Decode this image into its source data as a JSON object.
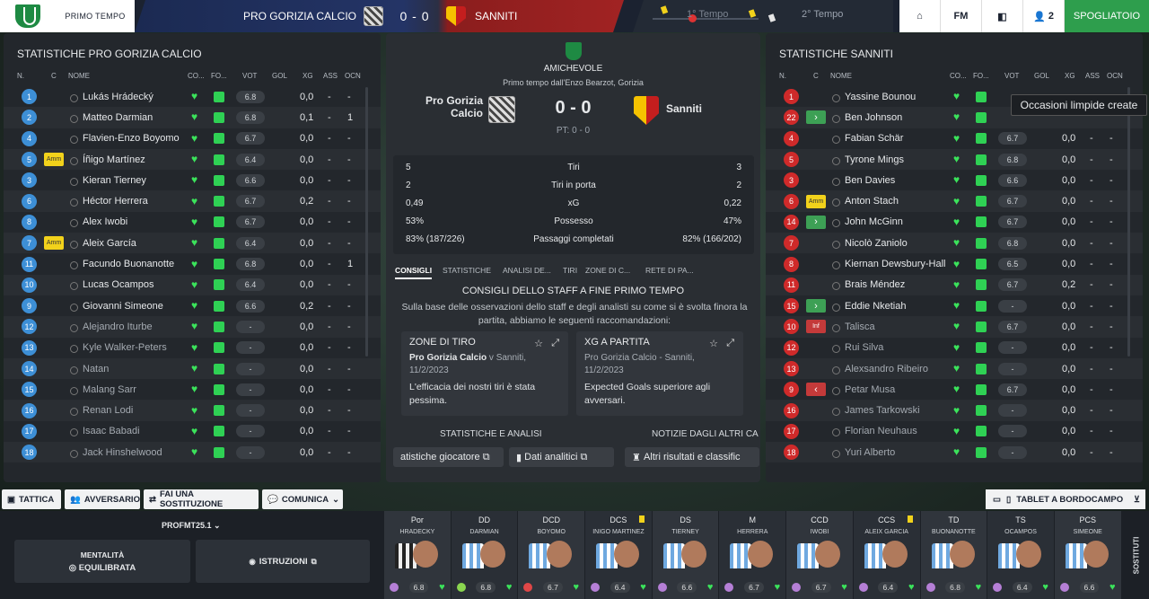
{
  "topbar": {
    "period": "PRIMO TEMPO",
    "home": "PRO GORIZIA CALCIO",
    "score": "0 - 0",
    "away": "SANNITI",
    "first_half": "1° Tempo",
    "second_half": "2° Tempo",
    "players_count": "2",
    "fm": "FM",
    "spogliatoio": "SPOGLIATOIO"
  },
  "left": {
    "title": "STATISTICHE PRO GORIZIA CALCIO"
  },
  "right": {
    "title": "STATISTICHE SANNITI"
  },
  "headers": {
    "n": "N.",
    "c": "C",
    "nome": "NOME",
    "co": "CO...",
    "fo": "FO...",
    "vot": "VOT",
    "gol": "GOL",
    "xg": "XG",
    "ass": "ASS",
    "ocn": "OCN"
  },
  "home_players": [
    {
      "n": "1",
      "c": "",
      "name": "Lukás Hrádecký",
      "vote": "6.8",
      "xg": "0,0",
      "ass": "-",
      "ocn": "-",
      "sub": false
    },
    {
      "n": "2",
      "c": "",
      "name": "Matteo Darmian",
      "vote": "6.8",
      "xg": "0,1",
      "ass": "-",
      "ocn": "1",
      "sub": false
    },
    {
      "n": "4",
      "c": "",
      "name": "Flavien-Enzo Boyomo",
      "vote": "6.7",
      "xg": "0,0",
      "ass": "-",
      "ocn": "-",
      "sub": false
    },
    {
      "n": "5",
      "c": "Amm",
      "name": "Íñigo Martínez",
      "vote": "6.4",
      "xg": "0,0",
      "ass": "-",
      "ocn": "-",
      "sub": false
    },
    {
      "n": "3",
      "c": "",
      "name": "Kieran Tierney",
      "vote": "6.6",
      "xg": "0,0",
      "ass": "-",
      "ocn": "-",
      "sub": false
    },
    {
      "n": "6",
      "c": "",
      "name": "Héctor Herrera",
      "vote": "6.7",
      "xg": "0,2",
      "ass": "-",
      "ocn": "-",
      "sub": false
    },
    {
      "n": "8",
      "c": "",
      "name": "Alex Iwobi",
      "vote": "6.7",
      "xg": "0,0",
      "ass": "-",
      "ocn": "-",
      "sub": false
    },
    {
      "n": "7",
      "c": "Amm",
      "name": "Aleix García",
      "vote": "6.4",
      "xg": "0,0",
      "ass": "-",
      "ocn": "-",
      "sub": false
    },
    {
      "n": "11",
      "c": "",
      "name": "Facundo Buonanotte",
      "vote": "6.8",
      "xg": "0,0",
      "ass": "-",
      "ocn": "1",
      "sub": false
    },
    {
      "n": "10",
      "c": "",
      "name": "Lucas Ocampos",
      "vote": "6.4",
      "xg": "0,0",
      "ass": "-",
      "ocn": "-",
      "sub": false
    },
    {
      "n": "9",
      "c": "",
      "name": "Giovanni Simeone",
      "vote": "6.6",
      "xg": "0,2",
      "ass": "-",
      "ocn": "-",
      "sub": false
    },
    {
      "n": "12",
      "c": "",
      "name": "Alejandro Iturbe",
      "vote": "-",
      "xg": "0,0",
      "ass": "-",
      "ocn": "-",
      "sub": true
    },
    {
      "n": "13",
      "c": "",
      "name": "Kyle Walker-Peters",
      "vote": "-",
      "xg": "0,0",
      "ass": "-",
      "ocn": "-",
      "sub": true
    },
    {
      "n": "14",
      "c": "",
      "name": "Natan",
      "vote": "-",
      "xg": "0,0",
      "ass": "-",
      "ocn": "-",
      "sub": true
    },
    {
      "n": "15",
      "c": "",
      "name": "Malang Sarr",
      "vote": "-",
      "xg": "0,0",
      "ass": "-",
      "ocn": "-",
      "sub": true
    },
    {
      "n": "16",
      "c": "",
      "name": "Renan Lodi",
      "vote": "-",
      "xg": "0,0",
      "ass": "-",
      "ocn": "-",
      "sub": true
    },
    {
      "n": "17",
      "c": "",
      "name": "Isaac Babadi",
      "vote": "-",
      "xg": "0,0",
      "ass": "-",
      "ocn": "-",
      "sub": true
    },
    {
      "n": "18",
      "c": "",
      "name": "Jack Hinshelwood",
      "vote": "-",
      "xg": "0,0",
      "ass": "-",
      "ocn": "-",
      "sub": true
    }
  ],
  "away_players": [
    {
      "n": "1",
      "c": "",
      "name": "Yassine Bounou",
      "vote": "",
      "xg": "",
      "ass": "",
      "ocn": "",
      "sub": false
    },
    {
      "n": "22",
      "c": "in",
      "name": "Ben Johnson",
      "vote": "",
      "xg": "",
      "ass": "",
      "ocn": "",
      "sub": false
    },
    {
      "n": "4",
      "c": "",
      "name": "Fabian Schär",
      "vote": "6.7",
      "xg": "0,0",
      "ass": "-",
      "ocn": "-",
      "sub": false
    },
    {
      "n": "5",
      "c": "",
      "name": "Tyrone Mings",
      "vote": "6.8",
      "xg": "0,0",
      "ass": "-",
      "ocn": "-",
      "sub": false
    },
    {
      "n": "3",
      "c": "",
      "name": "Ben Davies",
      "vote": "6.6",
      "xg": "0,0",
      "ass": "-",
      "ocn": "-",
      "sub": false
    },
    {
      "n": "6",
      "c": "Amm",
      "name": "Anton Stach",
      "vote": "6.7",
      "xg": "0,0",
      "ass": "-",
      "ocn": "-",
      "sub": false
    },
    {
      "n": "14",
      "c": "in",
      "name": "John McGinn",
      "vote": "6.7",
      "xg": "0,0",
      "ass": "-",
      "ocn": "-",
      "sub": false
    },
    {
      "n": "7",
      "c": "",
      "name": "Nicolò Zaniolo",
      "vote": "6.8",
      "xg": "0,0",
      "ass": "-",
      "ocn": "-",
      "sub": false
    },
    {
      "n": "8",
      "c": "",
      "name": "Kiernan Dewsbury-Hall",
      "vote": "6.5",
      "xg": "0,0",
      "ass": "-",
      "ocn": "-",
      "sub": false
    },
    {
      "n": "11",
      "c": "",
      "name": "Brais Méndez",
      "vote": "6.7",
      "xg": "0,2",
      "ass": "-",
      "ocn": "-",
      "sub": false
    },
    {
      "n": "15",
      "c": "in",
      "name": "Eddie Nketiah",
      "vote": "-",
      "xg": "0,0",
      "ass": "-",
      "ocn": "-",
      "sub": false
    },
    {
      "n": "10",
      "c": "Inf",
      "name": "Talisca",
      "vote": "6.7",
      "xg": "0,0",
      "ass": "-",
      "ocn": "-",
      "sub": true
    },
    {
      "n": "12",
      "c": "",
      "name": "Rui Silva",
      "vote": "-",
      "xg": "0,0",
      "ass": "-",
      "ocn": "-",
      "sub": true
    },
    {
      "n": "13",
      "c": "",
      "name": "Alexsandro Ribeiro",
      "vote": "-",
      "xg": "0,0",
      "ass": "-",
      "ocn": "-",
      "sub": true
    },
    {
      "n": "9",
      "c": "out",
      "name": "Petar Musa",
      "vote": "6.7",
      "xg": "0,0",
      "ass": "-",
      "ocn": "-",
      "sub": true
    },
    {
      "n": "16",
      "c": "",
      "name": "James Tarkowski",
      "vote": "-",
      "xg": "0,0",
      "ass": "-",
      "ocn": "-",
      "sub": true
    },
    {
      "n": "17",
      "c": "",
      "name": "Florian Neuhaus",
      "vote": "-",
      "xg": "0,0",
      "ass": "-",
      "ocn": "-",
      "sub": true
    },
    {
      "n": "18",
      "c": "",
      "name": "Yuri Alberto",
      "vote": "-",
      "xg": "0,0",
      "ass": "-",
      "ocn": "-",
      "sub": true
    }
  ],
  "tooltip": "Occasioni limpide create",
  "mid": {
    "competition": "AMICHEVOLE",
    "venue": "Primo tempo dall'Enzo Bearzot, Gorizia",
    "home_line1": "Pro Gorizia",
    "home_line2": "Calcio",
    "score": "0 - 0",
    "pt": "PT: 0 - 0",
    "away": "Sanniti",
    "stats": [
      {
        "h": "5",
        "label": "Tiri",
        "a": "3"
      },
      {
        "h": "2",
        "label": "Tiri in porta",
        "a": "2"
      },
      {
        "h": "0,49",
        "label": "xG",
        "a": "0,22"
      },
      {
        "h": "53%",
        "label": "Possesso",
        "a": "47%"
      },
      {
        "h": "83% (187/226)",
        "label": "Passaggi completati",
        "a": "82% (166/202)"
      }
    ],
    "tabs": [
      "CONSIGLI",
      "STATISTICHE",
      "ANALISI DE...",
      "TIRI",
      "ZONE DI C...",
      "RETE DI PA..."
    ],
    "advice_title": "CONSIGLI DELLO STAFF A FINE PRIMO TEMPO",
    "advice_desc": "Sulla base delle osservazioni dello staff e degli analisti su come si è svolta finora la partita, abbiamo le seguenti raccomandazioni:",
    "cards": [
      {
        "title": "ZONE DI TIRO",
        "match_b": "Pro Gorizia Calcio",
        "match_r": " v Sanniti, 11/2/2023",
        "body": "L'efficacia dei nostri tiri è stata pessima."
      },
      {
        "title": "XG A PARTITA",
        "match_b": "",
        "match_r": "Pro Gorizia Calcio - Sanniti, 11/2/2023",
        "body": "Expected Goals superiore agli avversari."
      }
    ],
    "section_a": "STATISTICHE E ANALISI",
    "section_b": "NOTIZIE DAGLI ALTRI CA",
    "pills": [
      "atistiche giocatore",
      "Dati analitici",
      "Altri risultati e classific"
    ]
  },
  "toolbar": {
    "tattica": "TATTICA",
    "avversario": "AVVERSARIO",
    "sost": "FAI UNA SOSTITUZIONE",
    "comunica": "COMUNICA",
    "tablet": "TABLET A BORDOCAMPO"
  },
  "bottom": {
    "tactic": "PROFMT25.1",
    "mentalita": "MENTALITÀ",
    "mentalita_val": "EQUILIBRATA",
    "istruzioni": "ISTRUZIONI",
    "sostituti": "SOSTITUTI"
  },
  "strip": [
    {
      "pos": "Por",
      "name": "HRÁDECKÝ",
      "rating": "6.8",
      "mood": "p",
      "yc": false
    },
    {
      "pos": "DD",
      "name": "DARMIAN",
      "rating": "6.8",
      "mood": "g",
      "yc": false
    },
    {
      "pos": "DCD",
      "name": "BOYOMO",
      "rating": "6.7",
      "mood": "r",
      "yc": false
    },
    {
      "pos": "DCS",
      "name": "ÍÑIGO MARTÍNEZ",
      "rating": "6.4",
      "mood": "p",
      "yc": true
    },
    {
      "pos": "DS",
      "name": "TIERNEY",
      "rating": "6.6",
      "mood": "p",
      "yc": false
    },
    {
      "pos": "M",
      "name": "HERRERA",
      "rating": "6.7",
      "mood": "p",
      "yc": false
    },
    {
      "pos": "CCD",
      "name": "IWOBI",
      "rating": "6.7",
      "mood": "p",
      "yc": false
    },
    {
      "pos": "CCS",
      "name": "ALEIX GARCÍA",
      "rating": "6.4",
      "mood": "p",
      "yc": true
    },
    {
      "pos": "TD",
      "name": "BUONANOTTE",
      "rating": "6.8",
      "mood": "p",
      "yc": false
    },
    {
      "pos": "TS",
      "name": "OCAMPOS",
      "rating": "6.4",
      "mood": "p",
      "yc": false
    },
    {
      "pos": "PCS",
      "name": "SIMEONE",
      "rating": "6.6",
      "mood": "p",
      "yc": false
    }
  ]
}
